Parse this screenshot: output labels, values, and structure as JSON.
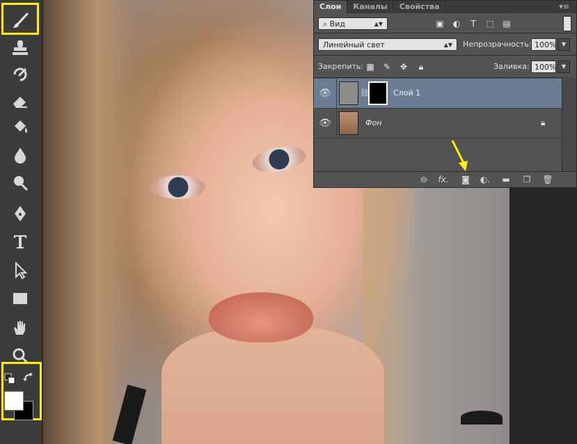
{
  "panel": {
    "tabs": [
      {
        "label": "Слои",
        "active": true
      },
      {
        "label": "Каналы",
        "active": false
      },
      {
        "label": "Свойства",
        "active": false
      }
    ],
    "filter_label": "Вид",
    "blend_mode": "Линейный свет",
    "opacity_label": "Непрозрачность:",
    "opacity_value": "100%",
    "lock_label": "Закрепить:",
    "fill_label": "Заливка:",
    "fill_value": "100%",
    "layers": [
      {
        "name": "Слой 1",
        "selected": true,
        "visible": true,
        "thumb": "gray-with-black-mask"
      },
      {
        "name": "Фон",
        "selected": false,
        "visible": true,
        "locked": true,
        "thumb": "photo"
      }
    ],
    "footer_icons": [
      "link-icon",
      "fx-icon",
      "add-mask-icon",
      "adjustment-layer-icon",
      "folder-icon",
      "new-layer-icon",
      "trash-icon"
    ]
  },
  "toolbar": {
    "tools": [
      "brush-icon",
      "clone-stamp-icon",
      "history-brush-icon",
      "eraser-icon",
      "paint-bucket-icon",
      "blur-icon",
      "dodge-icon",
      "pen-icon",
      "type-icon",
      "path-select-icon",
      "rectangle-icon",
      "hand-icon",
      "zoom-icon"
    ],
    "active_tool": "brush-icon",
    "foreground_color": "#ffffff",
    "background_color": "#000000"
  },
  "highlight_color": "#fff200"
}
